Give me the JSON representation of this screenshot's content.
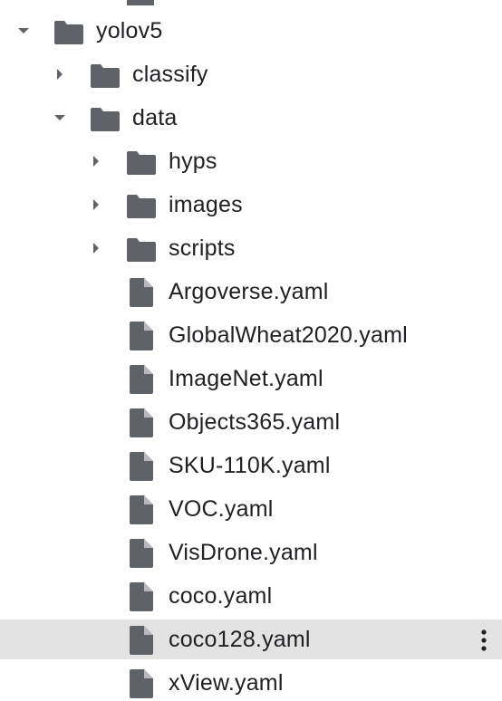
{
  "tree": {
    "items": [
      {
        "name": "yolov5",
        "kind": "folder",
        "depth": 0,
        "expanded": true,
        "has_children": true
      },
      {
        "name": "classify",
        "kind": "folder",
        "depth": 1,
        "expanded": false,
        "has_children": true
      },
      {
        "name": "data",
        "kind": "folder",
        "depth": 1,
        "expanded": true,
        "has_children": true
      },
      {
        "name": "hyps",
        "kind": "folder",
        "depth": 2,
        "expanded": false,
        "has_children": true
      },
      {
        "name": "images",
        "kind": "folder",
        "depth": 2,
        "expanded": false,
        "has_children": true
      },
      {
        "name": "scripts",
        "kind": "folder",
        "depth": 2,
        "expanded": false,
        "has_children": true
      },
      {
        "name": "Argoverse.yaml",
        "kind": "file",
        "depth": 2
      },
      {
        "name": "GlobalWheat2020.yaml",
        "kind": "file",
        "depth": 2
      },
      {
        "name": "ImageNet.yaml",
        "kind": "file",
        "depth": 2
      },
      {
        "name": "Objects365.yaml",
        "kind": "file",
        "depth": 2
      },
      {
        "name": "SKU-110K.yaml",
        "kind": "file",
        "depth": 2
      },
      {
        "name": "VOC.yaml",
        "kind": "file",
        "depth": 2
      },
      {
        "name": "VisDrone.yaml",
        "kind": "file",
        "depth": 2
      },
      {
        "name": "coco.yaml",
        "kind": "file",
        "depth": 2
      },
      {
        "name": "coco128.yaml",
        "kind": "file",
        "depth": 2,
        "selected": true,
        "show_more": true
      },
      {
        "name": "xView.yaml",
        "kind": "file",
        "depth": 2
      }
    ]
  },
  "icons": {
    "folder": "folder-icon",
    "file": "file-icon",
    "expanded": "caret-down-icon",
    "collapsed": "caret-right-icon",
    "more": "more-vert-icon"
  },
  "colors": {
    "icon": "#5f6368",
    "text": "#202124",
    "selected_bg": "#e3e3e3"
  }
}
